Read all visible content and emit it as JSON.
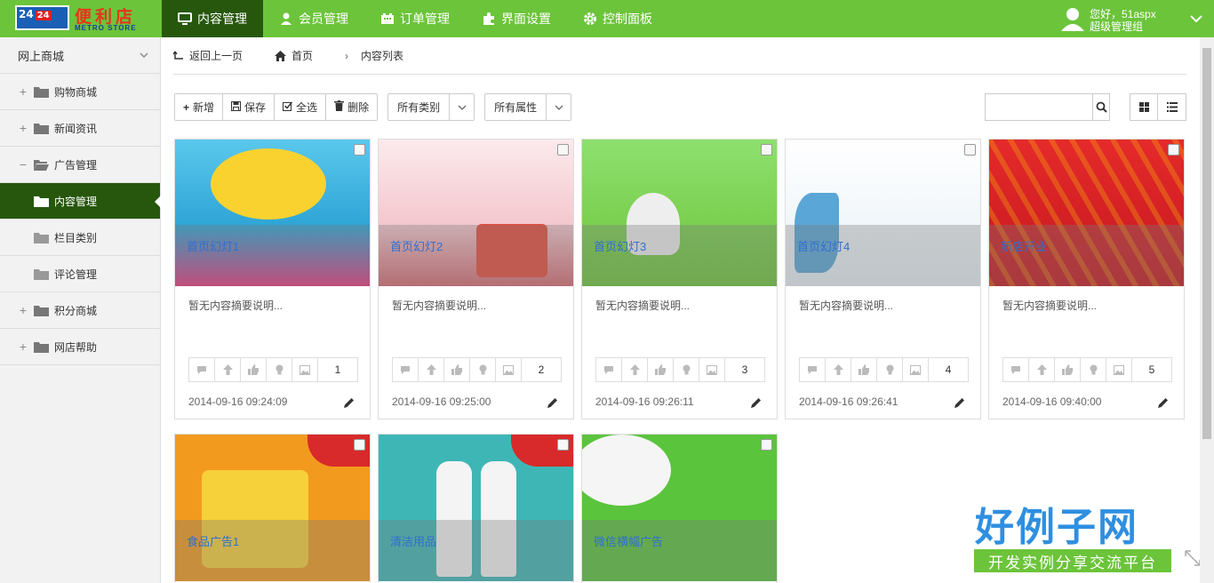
{
  "logo": {
    "badge": "24",
    "prefix": "24",
    "cn": "便利店",
    "en": "METRO STORE"
  },
  "nav": [
    {
      "label": "内容管理",
      "icon": "monitor-icon",
      "active": true
    },
    {
      "label": "会员管理",
      "icon": "user-icon"
    },
    {
      "label": "订单管理",
      "icon": "grid-icon"
    },
    {
      "label": "界面设置",
      "icon": "puzzle-icon"
    },
    {
      "label": "控制面板",
      "icon": "gear-icon"
    }
  ],
  "user": {
    "greeting": "您好，51aspx",
    "role": "超级管理组"
  },
  "sidebar": {
    "title": "网上商城",
    "items": [
      {
        "label": "购物商城",
        "toggle": "+"
      },
      {
        "label": "新闻资讯",
        "toggle": "+"
      },
      {
        "label": "广告管理",
        "toggle": "−"
      },
      {
        "label": "内容管理",
        "sub": true,
        "active": true
      },
      {
        "label": "栏目类别",
        "sub": true
      },
      {
        "label": "评论管理",
        "sub": true
      },
      {
        "label": "积分商城",
        "toggle": "+"
      },
      {
        "label": "网店帮助",
        "toggle": "+"
      }
    ]
  },
  "crumbs": {
    "back": "返回上一页",
    "home": "首页",
    "current": "内容列表"
  },
  "toolbar": {
    "add": "新增",
    "save": "保存",
    "select_all": "全选",
    "delete": "删除",
    "category": "所有类别",
    "attribute": "所有属性"
  },
  "search": {
    "placeholder": ""
  },
  "cards": [
    {
      "title": "首页幻灯1",
      "desc": "暂无内容摘要说明...",
      "count": "1",
      "date": "2014-09-16 09:24:09",
      "bg": "#3fb4e0"
    },
    {
      "title": "首页幻灯2",
      "desc": "暂无内容摘要说明...",
      "count": "2",
      "date": "2014-09-16 09:25:00",
      "bg": "#f4d7dc"
    },
    {
      "title": "首页幻灯3",
      "desc": "暂无内容摘要说明...",
      "count": "3",
      "date": "2014-09-16 09:26:11",
      "bg": "#7ed36a"
    },
    {
      "title": "首页幻灯4",
      "desc": "暂无内容摘要说明...",
      "count": "4",
      "date": "2014-09-16 09:26:41",
      "bg": "#eef4f8"
    },
    {
      "title": "新店开业",
      "desc": "暂无内容摘要说明...",
      "count": "5",
      "date": "2014-09-16 09:40:00",
      "bg": "#d8202a"
    },
    {
      "title": "食品广告1",
      "bg": "#f29a1e"
    },
    {
      "title": "清洁用品",
      "bg": "#3fb6b6"
    },
    {
      "title": "微信横幅广告",
      "bg": "#5ac43c"
    }
  ],
  "brand": {
    "big": "好例子网",
    "small": "开发实例分享交流平台"
  }
}
